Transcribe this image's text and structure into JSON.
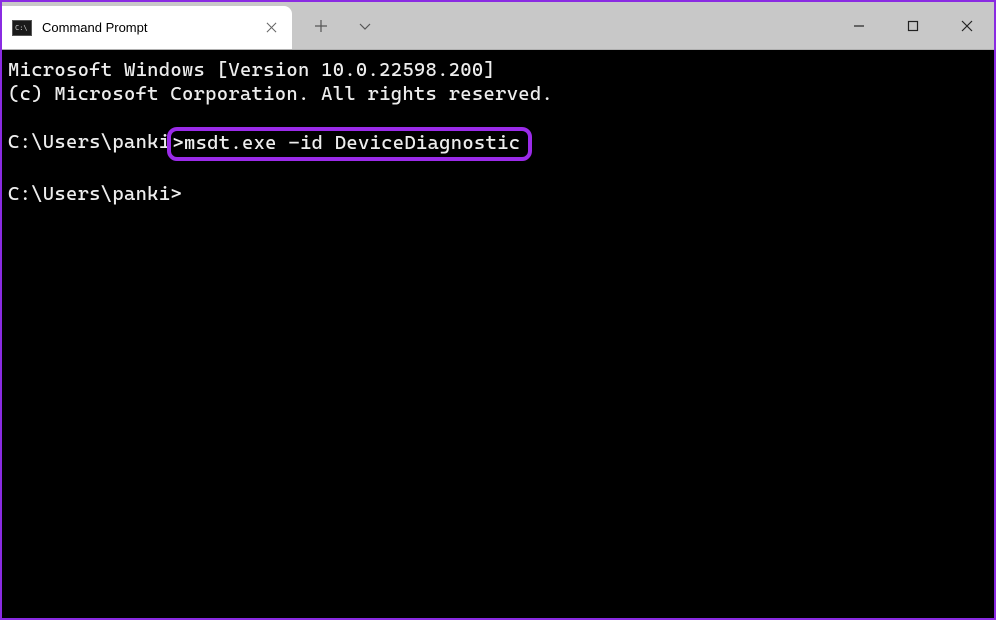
{
  "window": {
    "tab_title": "Command Prompt",
    "tab_icon_text": "C:\\"
  },
  "terminal": {
    "line1": "Microsoft Windows [Version 10.0.22598.200]",
    "line2": "(c) Microsoft Corporation. All rights reserved.",
    "prompt1_path": "C:\\Users\\panki",
    "prompt1_gt": ">",
    "command1": "msdt.exe -id DeviceDiagnostic",
    "prompt2": "C:\\Users\\panki>"
  }
}
